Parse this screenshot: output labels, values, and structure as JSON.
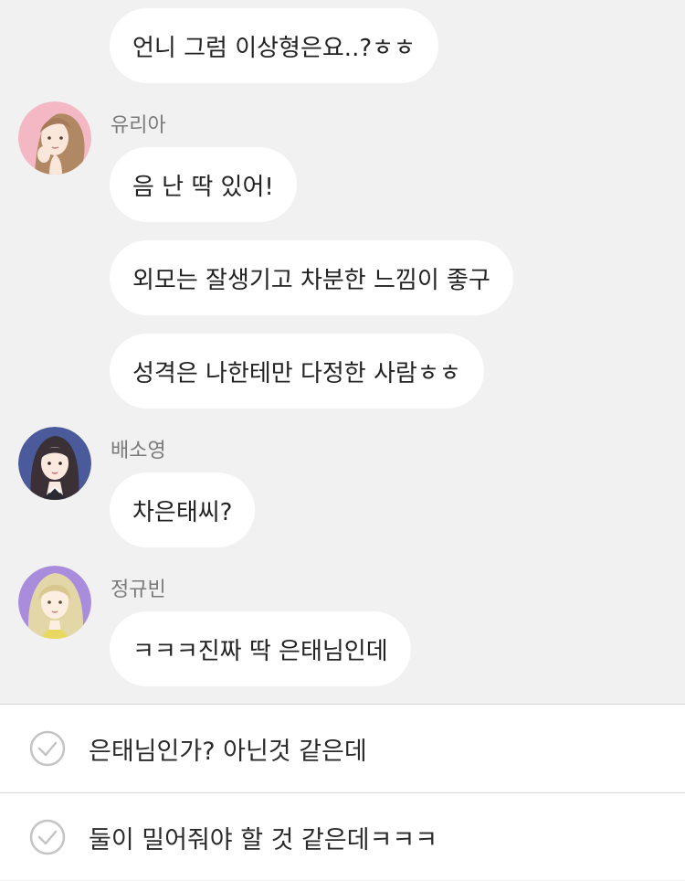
{
  "messages": [
    {
      "text": "언니 그럼 이상형은요..?ㅎㅎ"
    },
    {
      "sender": "유리아",
      "text": "음 난 딱 있어!"
    },
    {
      "text": "외모는 잘생기고 차분한 느낌이 좋구"
    },
    {
      "text": "성격은 나한테만 다정한 사람ㅎㅎ"
    },
    {
      "sender": "배소영",
      "text": "차은태씨?"
    },
    {
      "sender": "정규빈",
      "text": "ㅋㅋㅋ진짜 딱 은태님인데"
    }
  ],
  "reply_options": [
    {
      "label": "은태님인가? 아닌것 같은데",
      "icon": "check-circle-icon"
    },
    {
      "label": "둘이 밀어줘야 할 것 같은데ㅋㅋㅋ",
      "icon": "check-circle-icon"
    }
  ],
  "colors": {
    "chat_background": "#f1f1f1",
    "bubble": "#ffffff",
    "avatar_yuria": "#f4b8c4",
    "avatar_soyoung": "#4a5a9a",
    "avatar_gyubin": "#a98ddc"
  }
}
